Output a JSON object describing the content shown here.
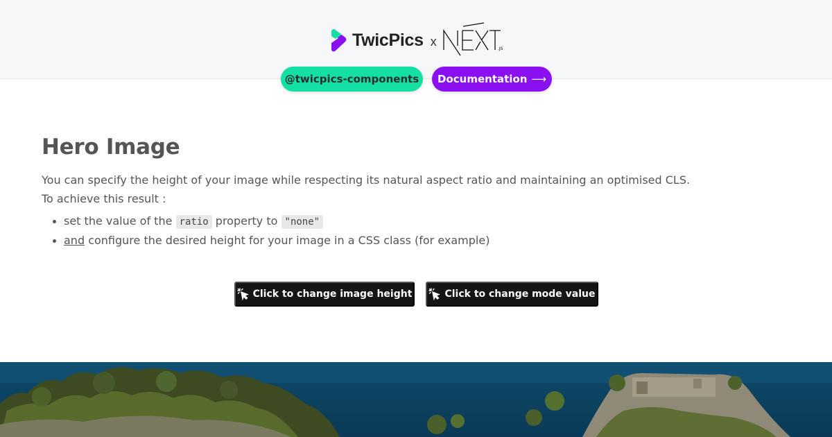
{
  "header": {
    "brand_name": "TwicPics",
    "separator": "x",
    "partner_logo": "NEXT.js",
    "links": {
      "components_label": "@twicpics-components",
      "documentation_label": "Documentation",
      "documentation_arrow": "⟶"
    },
    "colors": {
      "green": "#14e0a6",
      "purple": "#8a10f2"
    }
  },
  "main": {
    "title": "Hero Image",
    "intro": "You can specify the height of your image while respecting its natural aspect ratio and maintaining an optimised CLS.",
    "lead": "To achieve this result :",
    "bullets": {
      "b1_pre": "set the value of the",
      "b1_code1": "ratio",
      "b1_mid": "property to",
      "b1_code2": "\"none\"",
      "b2_underlined": "and",
      "b2_rest": "configure the desired height for your image in a CSS class (for example)"
    },
    "buttons": {
      "height_label": "Click to change image height",
      "mode_label": "Click to change mode value",
      "icon": "cursor-click-icon"
    }
  },
  "hero_image": {
    "icon": "coastal-island-photo"
  }
}
